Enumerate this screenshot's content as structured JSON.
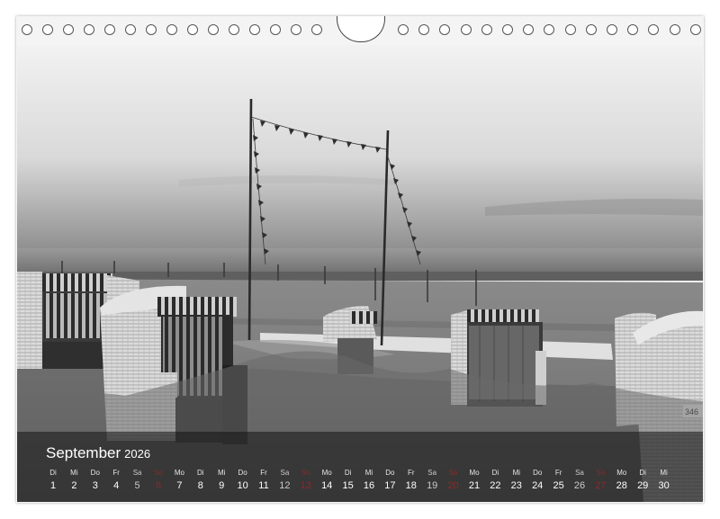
{
  "calendar": {
    "month": "September",
    "year": "2026",
    "days": [
      {
        "name": "Di",
        "num": "1"
      },
      {
        "name": "Mi",
        "num": "2"
      },
      {
        "name": "Do",
        "num": "3"
      },
      {
        "name": "Fr",
        "num": "4"
      },
      {
        "name": "Sa",
        "num": "5"
      },
      {
        "name": "So",
        "num": "6"
      },
      {
        "name": "Mo",
        "num": "7"
      },
      {
        "name": "Di",
        "num": "8"
      },
      {
        "name": "Mi",
        "num": "9"
      },
      {
        "name": "Do",
        "num": "10"
      },
      {
        "name": "Fr",
        "num": "11"
      },
      {
        "name": "Sa",
        "num": "12"
      },
      {
        "name": "So",
        "num": "13"
      },
      {
        "name": "Mo",
        "num": "14"
      },
      {
        "name": "Di",
        "num": "15"
      },
      {
        "name": "Mi",
        "num": "16"
      },
      {
        "name": "Do",
        "num": "17"
      },
      {
        "name": "Fr",
        "num": "18"
      },
      {
        "name": "Sa",
        "num": "19"
      },
      {
        "name": "So",
        "num": "20"
      },
      {
        "name": "Mo",
        "num": "21"
      },
      {
        "name": "Di",
        "num": "22"
      },
      {
        "name": "Mi",
        "num": "23"
      },
      {
        "name": "Do",
        "num": "24"
      },
      {
        "name": "Fr",
        "num": "25"
      },
      {
        "name": "Sa",
        "num": "26"
      },
      {
        "name": "So",
        "num": "27"
      },
      {
        "name": "Mo",
        "num": "28"
      },
      {
        "name": "Di",
        "num": "29"
      },
      {
        "name": "Mi",
        "num": "30"
      }
    ]
  },
  "photo": {
    "chair_number": "346"
  }
}
